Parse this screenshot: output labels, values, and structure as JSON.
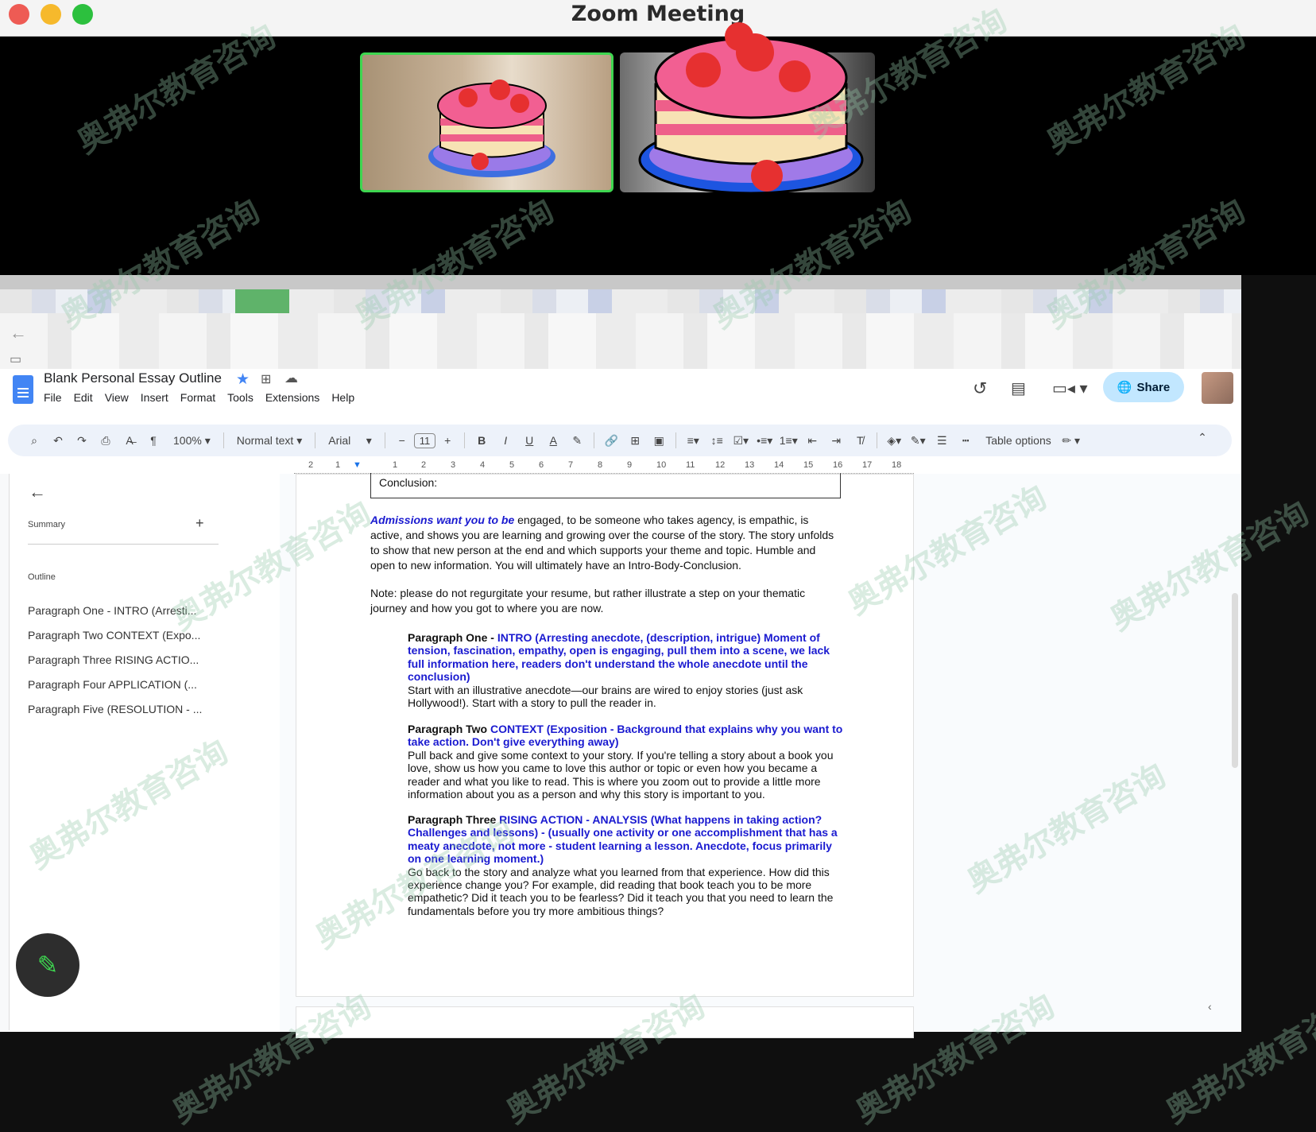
{
  "window": {
    "title": "Zoom Meeting"
  },
  "docs": {
    "title": "Blank Personal Essay Outline",
    "menu": [
      "File",
      "Edit",
      "View",
      "Insert",
      "Format",
      "Tools",
      "Extensions",
      "Help"
    ],
    "share_label": "Share"
  },
  "toolbar": {
    "zoom": "100%",
    "style": "Normal text",
    "font": "Arial",
    "font_size": "11",
    "table_options": "Table options"
  },
  "ruler_ticks": [
    "2",
    "1",
    "1",
    "2",
    "3",
    "4",
    "5",
    "6",
    "7",
    "8",
    "9",
    "10",
    "11",
    "12",
    "13",
    "14",
    "15",
    "16",
    "17",
    "18"
  ],
  "outline_panel": {
    "summary_label": "Summary",
    "outline_label": "Outline",
    "items": [
      "Paragraph One - INTRO (Arresti...",
      "Paragraph Two CONTEXT (Expo...",
      "Paragraph Three RISING ACTIO...",
      "Paragraph Four APPLICATION (...",
      "Paragraph Five (RESOLUTION - ..."
    ]
  },
  "document": {
    "conclusion_label": "Conclusion:",
    "intro_emph": "Admissions want you to be",
    "intro_rest": " engaged, to be someone who takes agency, is empathic, is active, and shows you are learning and growing over the course of the story. The story unfolds to show that new person at the end and which supports your theme and topic. Humble and open to new information. You will ultimately have an Intro-Body-Conclusion.",
    "note": "Note: please do not regurgitate your resume, but rather illustrate a step on your thematic journey and how you got to where you are now.",
    "p1_head": "Paragraph One - ",
    "p1_blue": "INTRO (Arresting anecdote, (description, intrigue) Moment of tension, fascination, empathy, open is engaging, pull them into a scene, we lack full information here, readers don't understand the whole anecdote until the conclusion)",
    "p1_body": "Start with an illustrative anecdote—our brains are wired to enjoy stories (just ask Hollywood!). Start with a story to pull the reader in.",
    "p2_head": "Paragraph Two ",
    "p2_blue": "CONTEXT (Exposition - Background that explains why you want to take action. Don't give everything away)",
    "p2_body": "Pull back and give some context to your story. If you're telling a story about a book you love, show us how you came to love this author or topic or even how you became a reader and what you like to read. This is where you zoom out to provide a little more information about you as a person and why this story is important to you.",
    "p3_head": "Paragraph Three ",
    "p3_blue": "RISING ACTION - ANALYSIS  (What happens in taking action? Challenges and lessons) - (usually one activity or one accomplishment that has a meaty anecdote, not more - student learning a lesson. Anecdote, focus primarily on one learning moment.)",
    "p3_body": "Go back to the story and analyze what you learned from that experience. How did this experience change you? For example, did reading that book teach you to be more empathetic? Did it teach you to be fearless? Did it teach you that you need to learn the fundamentals before you try more ambitious things?"
  },
  "watermark_text": "奥弗尔教育咨询",
  "colors": {
    "accent": "#3ed650",
    "share_bg": "#c2e7ff",
    "heading_blue": "#1a1ad0"
  }
}
